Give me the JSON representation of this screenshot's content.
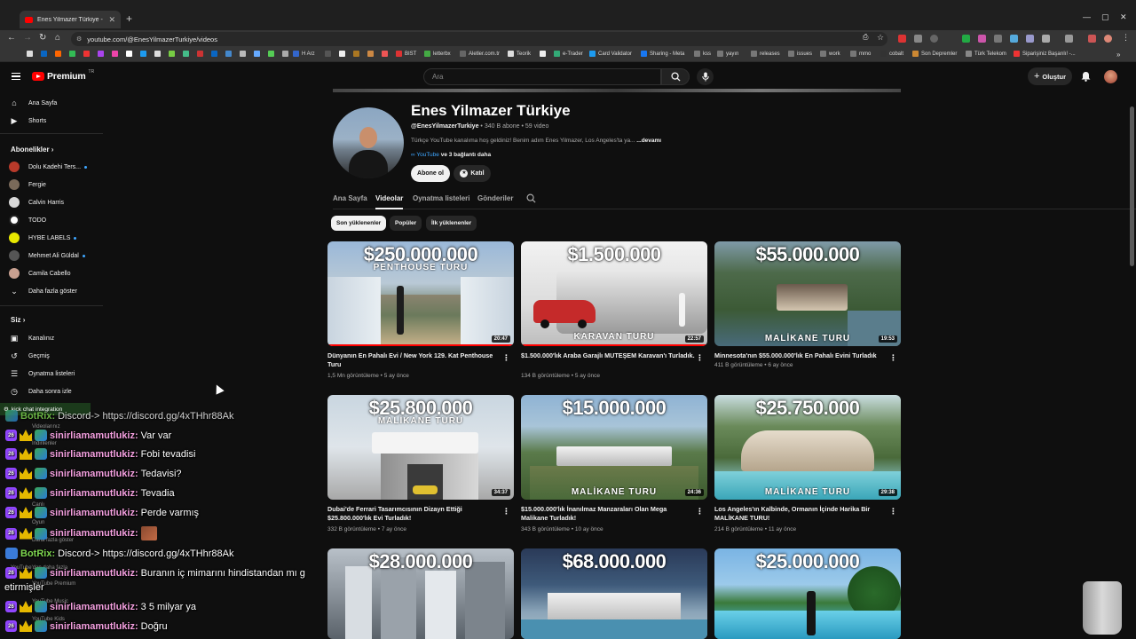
{
  "browser": {
    "tab_title": "Enes Yilmazer Türkiye - YouTube",
    "url": "youtube.com/@EnesYilmazerTurkiye/videos",
    "bookmarks": [
      "H Arz",
      "BIST",
      "letterbx",
      "Aletler.com.tr",
      "Teorik",
      "e-Trader",
      "Card Validator",
      "Sharing - Meta",
      "kss",
      "yayın",
      "releases",
      "issues",
      "work",
      "mmo",
      "cobalt",
      "Son Depremler",
      "Türk Telekom",
      "Siparişiniz Başarılı! -..."
    ]
  },
  "masthead": {
    "logo": "Premium",
    "logo_region": "TR",
    "search_placeholder": "Ara",
    "create_label": "Oluştur"
  },
  "sidebar": {
    "main": [
      {
        "label": "Ana Sayfa",
        "icon": "home-icon"
      },
      {
        "label": "Shorts",
        "icon": "shorts-icon"
      }
    ],
    "subscriptions_header": "Abonelikler",
    "subscriptions": [
      {
        "label": "Dolu Kadehi Ters...",
        "color": "#b83a2a",
        "live": true
      },
      {
        "label": "Fergie",
        "color": "#7a6a5a",
        "live": false
      },
      {
        "label": "Calvin Harris",
        "color": "#d8d8d8",
        "live": false
      },
      {
        "label": "TODO",
        "color": "#ffffff",
        "live": false
      },
      {
        "label": "HYBE LABELS",
        "color": "#e8e800",
        "live": true
      },
      {
        "label": "Mehmet Ali Güldal",
        "color": "#555555",
        "live": true
      },
      {
        "label": "Camila Cabello",
        "color": "#c8a090",
        "live": false
      }
    ],
    "show_more": "Daha fazla göster",
    "you_header": "Siz",
    "you_items": [
      {
        "label": "Kanalınız",
        "icon": "channel-icon"
      },
      {
        "label": "Geçmiş",
        "icon": "history-icon"
      },
      {
        "label": "Oynatma listeleri",
        "icon": "playlist-icon"
      },
      {
        "label": "Daha sonra izle",
        "icon": "clock-icon"
      }
    ],
    "ghost_items": [
      "Videolarınız",
      "İndirilenler",
      "Canlı",
      "Oyun",
      "Daha fazla göster",
      "YouTube'dan daha fazla",
      "YouTube Premium",
      "YouTube Music",
      "YouTube Kids"
    ]
  },
  "channel": {
    "name": "Enes Yilmazer Türkiye",
    "handle": "@EnesYilmazerTurkiye",
    "subscribers": "340 B abone",
    "videos": "59 video",
    "description": "Türkçe YouTube kanalıma hoş geldiniz! Benim adım Enes Yilmazer, Los Angeles'ta ya...",
    "more": "...devamı",
    "link_main": "YouTube",
    "link_more": "ve 3 bağlantı daha",
    "subscribe": "Abone ol",
    "join": "Katıl"
  },
  "tabs": [
    "Ana Sayfa",
    "Videolar",
    "Oynatma listeleri",
    "Gönderiler"
  ],
  "active_tab": "Videolar",
  "chips": [
    "Son yüklenenler",
    "Popüler",
    "İlk yüklenenler"
  ],
  "videos": [
    {
      "price": "$250.000.000",
      "subtitle": "PENTHOUSE TURU",
      "duration": "20:47",
      "title": "Dünyanın En Pahalı Evi / New York 129. Kat Penthouse Turu",
      "views": "1,5 Mn görüntüleme",
      "age": "5 ay önce",
      "watched": 1
    },
    {
      "price": "$1.500.000",
      "subtitle": "KARAVAN TURU",
      "duration": "22:57",
      "title": "$1.500.000'lık Araba Garajlı MUTEŞEM Karavan'ı Turladık.",
      "views": "134 B görüntüleme",
      "age": "5 ay önce",
      "watched": 1
    },
    {
      "price": "$55.000.000",
      "subtitle": "MALİKANE TURU",
      "duration": "19:53",
      "title": "Minnesota'nın $55.000.000'lık En Pahalı Evini Turladık",
      "views": "411 B görüntüleme",
      "age": "6 ay önce",
      "watched": 0
    },
    {
      "price": "$25.800.000",
      "subtitle": "MALİKANE TURU",
      "duration": "34:37",
      "title": "Dubai'de Ferrari Tasarımcısının Dizayn Ettiği $25.800.000'lık Evi Turladık!",
      "views": "332 B görüntüleme",
      "age": "7 ay önce",
      "watched": 0
    },
    {
      "price": "$15.000.000",
      "subtitle": "MALİKANE TURU",
      "duration": "24:36",
      "title": "$15.000.000'lık İnanılmaz Manzaraları Olan Mega Malikane Turladık!",
      "views": "343 B görüntüleme",
      "age": "10 ay önce",
      "watched": 0
    },
    {
      "price": "$25.750.000",
      "subtitle": "MALİKANE TURU",
      "duration": "29:38",
      "title": "Los Angeles'ın Kalbinde, Ormanın İçinde Harika Bir MALİKANE TURU!",
      "views": "214 B görüntüleme",
      "age": "11 ay önce",
      "watched": 0
    },
    {
      "price": "$28.000.000",
      "subtitle": "",
      "duration": "",
      "title": "",
      "views": "",
      "age": "",
      "watched": 0
    },
    {
      "price": "$68.000.000",
      "subtitle": "",
      "duration": "",
      "title": "",
      "views": "",
      "age": "",
      "watched": 0
    },
    {
      "price": "$25.000.000",
      "subtitle": "",
      "duration": "",
      "title": "",
      "views": "",
      "age": "",
      "watched": 0
    }
  ],
  "chat": {
    "integration_label": "kick chat integration",
    "messages": [
      {
        "user": "BotRix:",
        "text": "Discord-> https://discord.gg/4xTHhr88Ak",
        "bot": true,
        "badge": "",
        "clipped": true
      },
      {
        "user": "sinirliamamutlukiz:",
        "text": "Var var",
        "bot": false,
        "badge": "26"
      },
      {
        "user": "sinirliamamutlukiz:",
        "text": "Fobi tevadisi",
        "bot": false,
        "badge": "26"
      },
      {
        "user": "sinirliamamutlukiz:",
        "text": "Tedavisi?",
        "bot": false,
        "badge": "26"
      },
      {
        "user": "sinirliamamutlukiz:",
        "text": "Tevadia",
        "bot": false,
        "badge": "26"
      },
      {
        "user": "sinirliamamutlukiz:",
        "text": "Perde varmış",
        "bot": false,
        "badge": "26"
      },
      {
        "user": "sinirliamamutlukiz:",
        "text": "",
        "bot": false,
        "badge": "26",
        "emote": true
      },
      {
        "user": "BotRix:",
        "text": "Discord-> https://discord.gg/4xTHhr88Ak",
        "bot": true,
        "badge": ""
      },
      {
        "user": "sinirliamamutlukiz:",
        "text": "Buranın iç mimarını hindistandan mı g",
        "bot": false,
        "badge": "26"
      },
      {
        "user": "",
        "text": "etirmişler",
        "bot": false,
        "badge": "",
        "continuation": true
      },
      {
        "user": "sinirliamamutlukiz:",
        "text": "3 5 milyar ya",
        "bot": false,
        "badge": "26"
      },
      {
        "user": "sinirliamamutlukiz:",
        "text": "Doğru",
        "bot": false,
        "badge": "26"
      }
    ]
  },
  "colors": {
    "background": "#0f0f0f",
    "youtube_red": "#ff0000",
    "link_blue": "#3ea6ff",
    "chat_user": "#f5a0e0",
    "chat_bot": "#7fd850"
  }
}
